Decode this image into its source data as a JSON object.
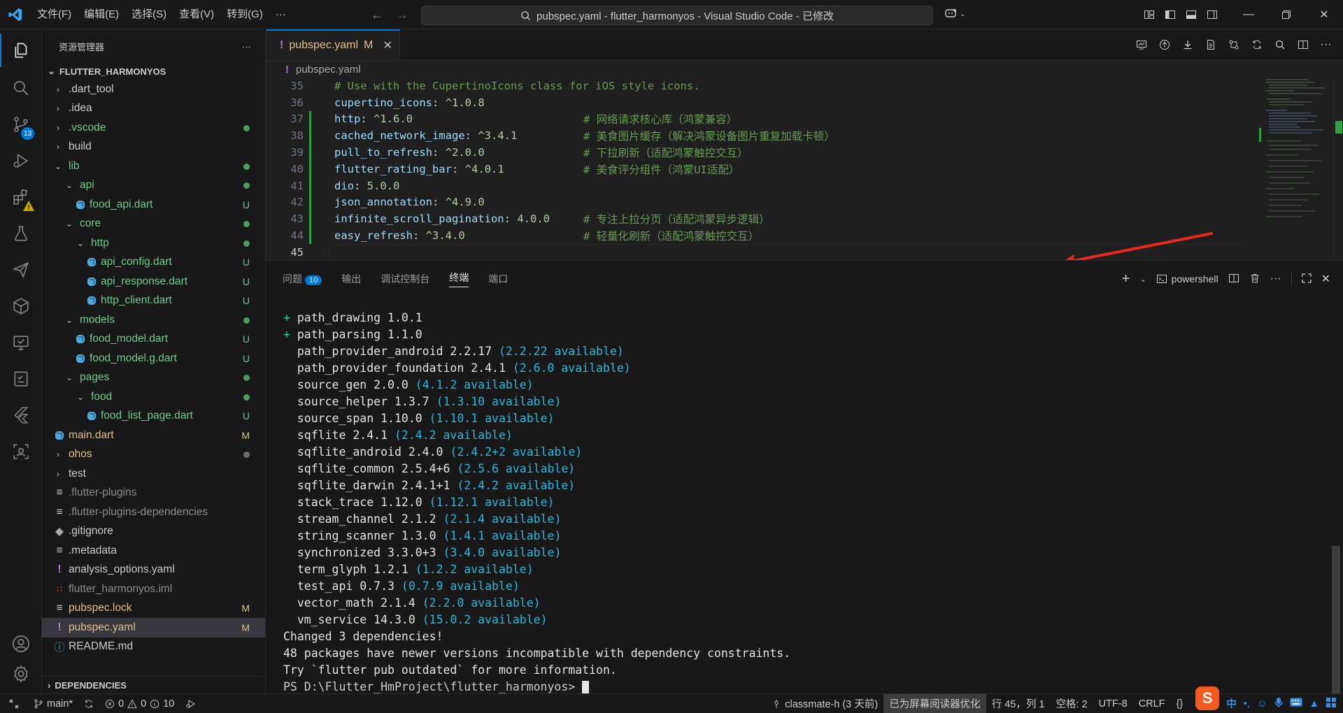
{
  "titlebar": {
    "menu": [
      "文件(F)",
      "编辑(E)",
      "选择(S)",
      "查看(V)",
      "转到(G)",
      "···"
    ],
    "search_text": "pubspec.yaml - flutter_harmonyos - Visual Studio Code - 已修改"
  },
  "activity": {
    "scm_badge": "13"
  },
  "explorer": {
    "header": "资源管理器",
    "more": "···",
    "root": "FLUTTER_HARMONYOS",
    "rows": [
      {
        "label": ".dart_tool",
        "type": "folder",
        "depth": 0,
        "open": false,
        "color": "norm",
        "deco": ""
      },
      {
        "label": ".idea",
        "type": "folder",
        "depth": 0,
        "open": false,
        "color": "norm",
        "deco": ""
      },
      {
        "label": ".vscode",
        "type": "folder",
        "depth": 0,
        "open": false,
        "color": "green",
        "deco": "dot"
      },
      {
        "label": "build",
        "type": "folder",
        "depth": 0,
        "open": false,
        "color": "norm",
        "deco": ""
      },
      {
        "label": "lib",
        "type": "folder",
        "depth": 0,
        "open": true,
        "color": "green",
        "deco": "dot"
      },
      {
        "label": "api",
        "type": "folder",
        "depth": 1,
        "open": true,
        "color": "green",
        "deco": "dot"
      },
      {
        "label": "food_api.dart",
        "type": "dart",
        "depth": 1,
        "color": "green",
        "deco": "U"
      },
      {
        "label": "core",
        "type": "folder",
        "depth": 1,
        "open": true,
        "color": "green",
        "deco": "dot"
      },
      {
        "label": "http",
        "type": "folder",
        "depth": 2,
        "open": true,
        "color": "green",
        "deco": "dot"
      },
      {
        "label": "api_config.dart",
        "type": "dart",
        "depth": 2,
        "color": "green",
        "deco": "U"
      },
      {
        "label": "api_response.dart",
        "type": "dart",
        "depth": 2,
        "color": "green",
        "deco": "U"
      },
      {
        "label": "http_client.dart",
        "type": "dart",
        "depth": 2,
        "color": "green",
        "deco": "U"
      },
      {
        "label": "models",
        "type": "folder",
        "depth": 1,
        "open": true,
        "color": "green",
        "deco": "dot"
      },
      {
        "label": "food_model.dart",
        "type": "dart",
        "depth": 1,
        "color": "green",
        "deco": "U"
      },
      {
        "label": "food_model.g.dart",
        "type": "dart",
        "depth": 1,
        "color": "green",
        "deco": "U"
      },
      {
        "label": "pages",
        "type": "folder",
        "depth": 1,
        "open": true,
        "color": "green",
        "deco": "dot"
      },
      {
        "label": "food",
        "type": "folder",
        "depth": 2,
        "open": true,
        "color": "green",
        "deco": "dot"
      },
      {
        "label": "food_list_page.dart",
        "type": "dart",
        "depth": 2,
        "color": "green",
        "deco": "U"
      },
      {
        "label": "main.dart",
        "type": "dart",
        "depth": 0,
        "color": "mod",
        "deco": "M"
      },
      {
        "label": "ohos",
        "type": "folder",
        "depth": 0,
        "open": false,
        "color": "mod",
        "deco": "dotgray"
      },
      {
        "label": "test",
        "type": "folder",
        "depth": 0,
        "open": false,
        "color": "norm",
        "deco": ""
      },
      {
        "label": ".flutter-plugins",
        "type": "list",
        "depth": 0,
        "color": "gray",
        "deco": ""
      },
      {
        "label": ".flutter-plugins-dependencies",
        "type": "list",
        "depth": 0,
        "color": "gray",
        "deco": ""
      },
      {
        "label": ".gitignore",
        "type": "git",
        "depth": 0,
        "color": "norm",
        "deco": ""
      },
      {
        "label": ".metadata",
        "type": "list",
        "depth": 0,
        "color": "norm",
        "deco": ""
      },
      {
        "label": "analysis_options.yaml",
        "type": "yaml",
        "depth": 0,
        "color": "norm",
        "deco": ""
      },
      {
        "label": "flutter_harmonyos.iml",
        "type": "rss",
        "depth": 0,
        "color": "gray",
        "deco": ""
      },
      {
        "label": "pubspec.lock",
        "type": "list",
        "depth": 0,
        "color": "mod",
        "deco": "M"
      },
      {
        "label": "pubspec.yaml",
        "type": "yaml",
        "depth": 0,
        "color": "mod",
        "deco": "M",
        "selected": true
      },
      {
        "label": "README.md",
        "type": "info",
        "depth": 0,
        "color": "norm",
        "deco": ""
      }
    ],
    "dependencies": "DEPENDENCIES"
  },
  "editor": {
    "tab_label": "pubspec.yaml",
    "tab_status": "M",
    "breadcrumb": "pubspec.yaml",
    "lines": [
      {
        "n": "35",
        "key": "",
        "val": "",
        "cmt": "# Use with the CupertinoIcons class for iOS style icons.",
        "added": false
      },
      {
        "n": "36",
        "key": "cupertino_icons",
        "val": "^1.0.8",
        "cmt": "",
        "added": false
      },
      {
        "n": "37",
        "key": "http",
        "val": "^1.6.0",
        "cmt": "# 网络请求核心库（鸿蒙兼容）",
        "added": true
      },
      {
        "n": "38",
        "key": "cached_network_image",
        "val": "^3.4.1",
        "cmt": "# 美食图片缓存（解决鸿蒙设备图片重复加载卡顿）",
        "added": true
      },
      {
        "n": "39",
        "key": "pull_to_refresh",
        "val": "^2.0.0",
        "cmt": "# 下拉刷新（适配鸿蒙触控交互）",
        "added": true
      },
      {
        "n": "40",
        "key": "flutter_rating_bar",
        "val": "^4.0.1",
        "cmt": "# 美食评分组件（鸿蒙UI适配）",
        "added": true
      },
      {
        "n": "41",
        "key": "dio",
        "val": "5.0.0",
        "cmt": "",
        "added": true
      },
      {
        "n": "42",
        "key": "json_annotation",
        "val": "^4.9.0",
        "cmt": "",
        "added": true
      },
      {
        "n": "43",
        "key": "infinite_scroll_pagination",
        "val": "4.0.0",
        "cmt": "# 专注上拉分页（适配鸿蒙异步逻辑）",
        "added": true
      },
      {
        "n": "44",
        "key": "easy_refresh",
        "val": "^3.4.0",
        "cmt": "# 轻量化刷新（适配鸿蒙触控交互）",
        "added": true
      },
      {
        "n": "45",
        "key": "",
        "val": "",
        "cmt": "",
        "added": false,
        "current": true
      }
    ]
  },
  "panel": {
    "tabs": [
      {
        "label": "问题",
        "badge": "10"
      },
      {
        "label": "输出"
      },
      {
        "label": "调试控制台"
      },
      {
        "label": "终端",
        "active": true
      },
      {
        "label": "端口"
      }
    ],
    "shell": "powershell",
    "terminal": [
      {
        "prefix": "+ ",
        "pkg": "path_drawing 1.0.1",
        "avail": ""
      },
      {
        "prefix": "+ ",
        "pkg": "path_parsing 1.1.0",
        "avail": ""
      },
      {
        "prefix": "  ",
        "pkg": "path_provider_android 2.2.17",
        "avail": "(2.2.22 available)"
      },
      {
        "prefix": "  ",
        "pkg": "path_provider_foundation 2.4.1",
        "avail": "(2.6.0 available)"
      },
      {
        "prefix": "  ",
        "pkg": "source_gen 2.0.0",
        "avail": "(4.1.2 available)"
      },
      {
        "prefix": "  ",
        "pkg": "source_helper 1.3.7",
        "avail": "(1.3.10 available)"
      },
      {
        "prefix": "  ",
        "pkg": "source_span 1.10.0",
        "avail": "(1.10.1 available)"
      },
      {
        "prefix": "  ",
        "pkg": "sqflite 2.4.1",
        "avail": "(2.4.2 available)"
      },
      {
        "prefix": "  ",
        "pkg": "sqflite_android 2.4.0",
        "avail": "(2.4.2+2 available)"
      },
      {
        "prefix": "  ",
        "pkg": "sqflite_common 2.5.4+6",
        "avail": "(2.5.6 available)"
      },
      {
        "prefix": "  ",
        "pkg": "sqflite_darwin 2.4.1+1",
        "avail": "(2.4.2 available)"
      },
      {
        "prefix": "  ",
        "pkg": "stack_trace 1.12.0",
        "avail": "(1.12.1 available)"
      },
      {
        "prefix": "  ",
        "pkg": "stream_channel 2.1.2",
        "avail": "(2.1.4 available)"
      },
      {
        "prefix": "  ",
        "pkg": "string_scanner 1.3.0",
        "avail": "(1.4.1 available)"
      },
      {
        "prefix": "  ",
        "pkg": "synchronized 3.3.0+3",
        "avail": "(3.4.0 available)"
      },
      {
        "prefix": "  ",
        "pkg": "term_glyph 1.2.1",
        "avail": "(1.2.2 available)"
      },
      {
        "prefix": "  ",
        "pkg": "test_api 0.7.3",
        "avail": "(0.7.9 available)"
      },
      {
        "prefix": "  ",
        "pkg": "vector_math 2.1.4",
        "avail": "(2.2.0 available)"
      },
      {
        "prefix": "  ",
        "pkg": "vm_service 14.3.0",
        "avail": "(15.0.2 available)"
      },
      {
        "prefix": "",
        "pkg": "Changed 3 dependencies!",
        "avail": ""
      },
      {
        "prefix": "",
        "pkg": "48 packages have newer versions incompatible with dependency constraints.",
        "avail": ""
      },
      {
        "prefix": "",
        "pkg": "Try `flutter pub outdated` for more information.",
        "avail": ""
      }
    ],
    "prompt": "PS D:\\Flutter_HmProject\\flutter_harmonyos> "
  },
  "status": {
    "branch": "main*",
    "errors": "0",
    "warnings": "0",
    "info": "10",
    "user": "classmate-h (3 天前)",
    "screen_reader": "已为屏幕阅读器优化",
    "position": "行 45，列 1",
    "spaces": "空格: 2",
    "encoding": "UTF-8",
    "eol": "CRLF",
    "lang": "{}",
    "ime_lang": "中"
  },
  "colors": {
    "accent": "#0078d4",
    "added_gutter": "#2ea043",
    "untracked": "#73c991",
    "modified": "#e2c08d",
    "annotation_arrow": "#e8291c"
  }
}
